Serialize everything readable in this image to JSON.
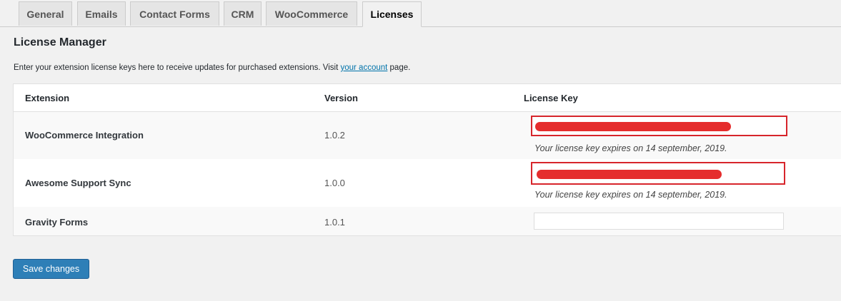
{
  "tabs": [
    {
      "label": "General"
    },
    {
      "label": "Emails"
    },
    {
      "label": "Contact Forms"
    },
    {
      "label": "CRM"
    },
    {
      "label": "WooCommerce"
    },
    {
      "label": "Licenses"
    }
  ],
  "active_tab": "Licenses",
  "page": {
    "title": "License Manager",
    "description_before": "Enter your extension license keys here to receive updates for purchased extensions. Visit ",
    "description_link": "your account",
    "description_after": " page."
  },
  "table": {
    "headers": {
      "extension": "Extension",
      "version": "Version",
      "license_key": "License Key"
    },
    "rows": [
      {
        "extension": "WooCommerce Integration",
        "version": "1.0.2",
        "license_key_redacted": true,
        "expiry": "Your license key expires on 14 september, 2019."
      },
      {
        "extension": "Awesome Support Sync",
        "version": "1.0.0",
        "license_key_redacted": true,
        "expiry": "Your license key expires on 14 september, 2019."
      },
      {
        "extension": "Gravity Forms",
        "version": "1.0.1",
        "license_key_redacted": false,
        "license_key": ""
      }
    ]
  },
  "save_button": {
    "label": "Save changes"
  },
  "colors": {
    "page_background": "#f1f1f1",
    "primary_button": "#2e7fb7",
    "link": "#0073aa",
    "highlight_border": "#d7252b",
    "redaction": "#e52d2d"
  }
}
